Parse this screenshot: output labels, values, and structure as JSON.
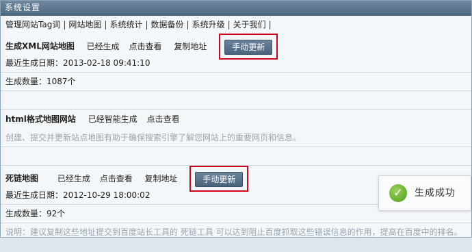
{
  "window": {
    "title": "系统设置"
  },
  "nav": {
    "items": [
      "管理网站Tag词",
      "网站地图",
      "系统统计",
      "数据备份",
      "系统升级",
      "关于我们"
    ],
    "separator": "|"
  },
  "xml_sitemap": {
    "title": "生成XML网站地图",
    "status": "已经生成",
    "view_link": "点击查看",
    "copy_link": "复制地址",
    "button": "手动更新",
    "last_date": "最近生成日期：2013-02-18 09:41:10",
    "count": "生成数量：1087个"
  },
  "html_sitemap": {
    "title": "html格式地图网站",
    "status": "已经智能生成",
    "view_link": "点击查看",
    "description": "创建、提交并更新站点地图有助于确保搜索引擎了解您网站上的重要网页和信息。"
  },
  "deadlink": {
    "title": "死链地图",
    "status": "已经生成",
    "view_link": "点击查看",
    "copy_link": "复制地址",
    "button": "手动更新",
    "last_date": "最近生成日期：2012-10-29 18:00:02",
    "count": "生成数量：92个",
    "note": "说明：建议复制这些地址提交到百度站长工具的 死链工具 可以达到阻止百度抓取这些错误信息的作用，提高在百度中的排名。"
  },
  "toast": {
    "icon": "check-icon",
    "message": "生成成功"
  },
  "colors": {
    "titlebar": "#5a7490",
    "button": "#56708a",
    "highlight": "#d0021b",
    "success": "#5aa621"
  }
}
